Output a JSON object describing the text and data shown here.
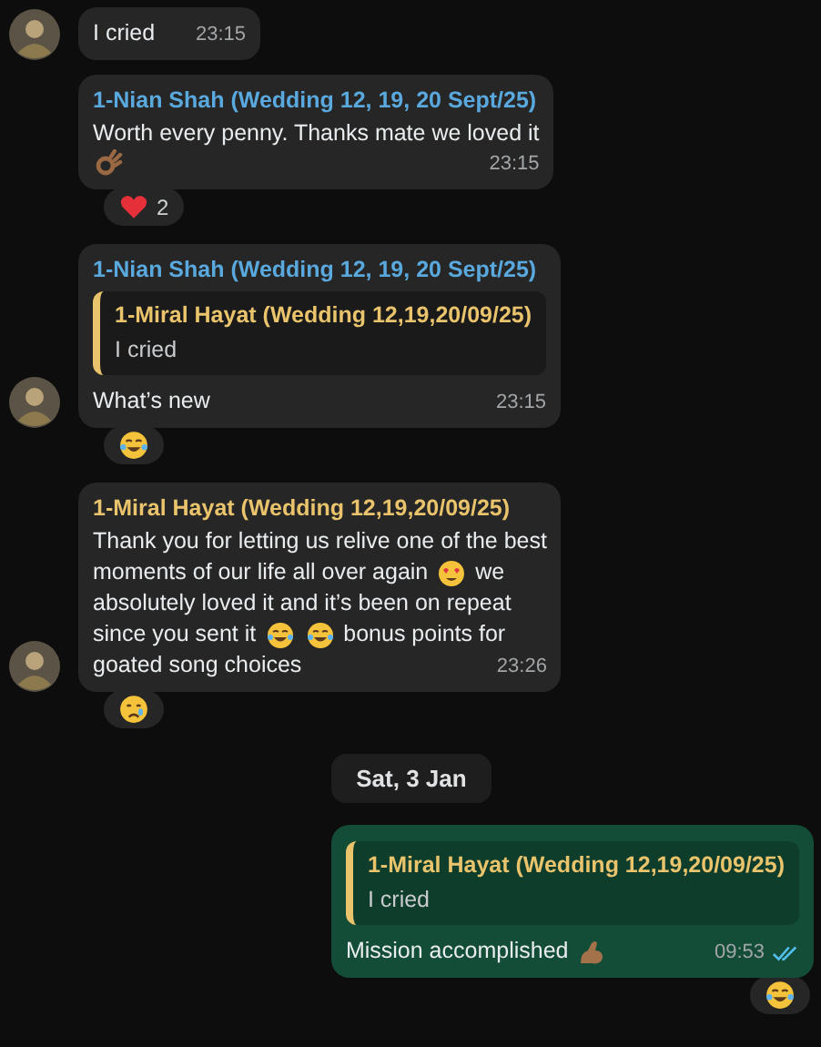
{
  "messages": [
    {
      "kind": "in",
      "avatar": true,
      "lines": [
        [
          {
            "kind": "text",
            "text": "I cried"
          }
        ]
      ],
      "time": "23:15"
    },
    {
      "kind": "in",
      "avatar": false,
      "sender": {
        "name": "1-Nian Shah (Wedding 12, 19, 20 Sept/25)",
        "color": "#5aa9de"
      },
      "lines": [
        [
          {
            "kind": "text",
            "text": "Worth every penny. Thanks mate we loved it"
          }
        ],
        [
          {
            "kind": "ok"
          }
        ]
      ],
      "time": "23:15",
      "reaction": {
        "kind": "heart",
        "count": "2"
      }
    },
    {
      "kind": "in",
      "avatar": true,
      "sender": {
        "name": "1-Nian Shah (Wedding 12, 19, 20 Sept/25)",
        "color": "#5aa9de"
      },
      "quote": {
        "name": "1-Miral Hayat (Wedding 12,19,20/09/25)",
        "color": "#eac46c",
        "text": "I cried"
      },
      "lines": [
        [
          {
            "kind": "text",
            "text": "What’s new"
          }
        ]
      ],
      "time": "23:15",
      "reaction": {
        "kind": "laugh"
      }
    },
    {
      "kind": "in",
      "avatar": true,
      "sender": {
        "name": "1-Miral Hayat (Wedding 12,19,20/09/25)",
        "color": "#eac46c"
      },
      "lines": [
        [
          {
            "kind": "text",
            "text": "Thank you for letting us relive one of the best"
          }
        ],
        [
          {
            "kind": "text",
            "text": "moments of our life all over again"
          },
          {
            "kind": "hearteyes"
          },
          {
            "kind": "text",
            "text": "we"
          }
        ],
        [
          {
            "kind": "text",
            "text": "absolutely loved it and it’s been on repeat"
          }
        ],
        [
          {
            "kind": "text",
            "text": "since you sent it"
          },
          {
            "kind": "laugh"
          },
          {
            "kind": "laugh"
          },
          {
            "kind": "text",
            "text": "bonus points for"
          }
        ],
        [
          {
            "kind": "text",
            "text": "goated song choices"
          }
        ]
      ],
      "time": "23:26",
      "reaction": {
        "kind": "cry"
      }
    },
    {
      "kind": "date",
      "text": "Sat, 3 Jan"
    },
    {
      "kind": "out",
      "quote": {
        "name": "1-Miral Hayat (Wedding 12,19,20/09/25)",
        "color": "#eac46c",
        "text": "I cried"
      },
      "lines": [
        [
          {
            "kind": "text",
            "text": "Mission accomplished"
          },
          {
            "kind": "muscle"
          }
        ]
      ],
      "time": "09:53",
      "read": true,
      "reaction": {
        "kind": "laugh"
      }
    }
  ]
}
